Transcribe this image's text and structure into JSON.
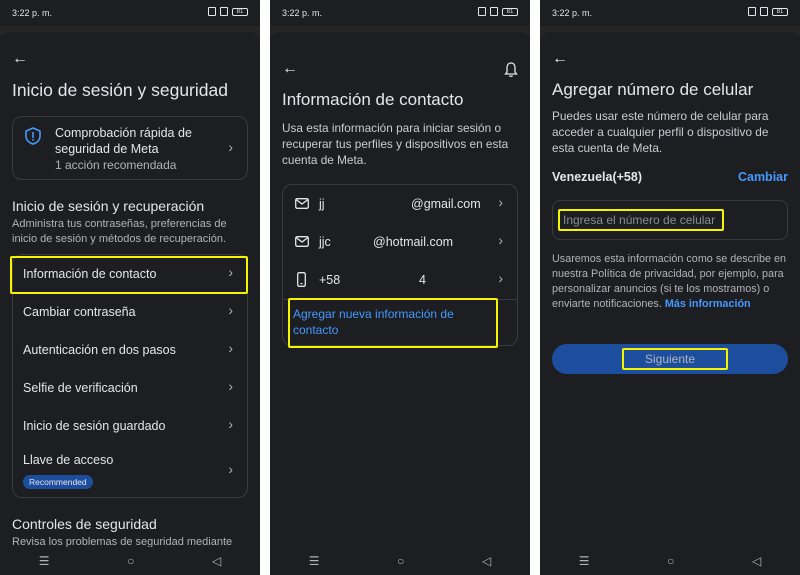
{
  "status": {
    "time": "3:22 p. m.",
    "battery": "81"
  },
  "screen1": {
    "title": "Inicio de sesión y seguridad",
    "quick_check": {
      "title": "Comprobación rápida de seguridad de Meta",
      "subtitle": "1 acción recomendada"
    },
    "section_title": "Inicio de sesión y recuperación",
    "section_desc": "Administra tus contraseñas, preferencias de inicio de sesión y métodos de recuperación.",
    "items": [
      {
        "label": "Información de contacto"
      },
      {
        "label": "Cambiar contraseña"
      },
      {
        "label": "Autenticación en dos pasos"
      },
      {
        "label": "Selfie de verificación"
      },
      {
        "label": "Inicio de sesión guardado"
      },
      {
        "label": "Llave de acceso",
        "badge": "Recommended"
      }
    ],
    "security_title": "Controles de seguridad",
    "security_desc": "Revisa los problemas de seguridad mediante"
  },
  "screen2": {
    "title": "Información de contacto",
    "desc": "Usa esta información para iniciar sesión o recuperar tus perfiles y dispositivos en esta cuenta de Meta.",
    "contacts": [
      {
        "prefix": "jj",
        "value": "@gmail.com",
        "icon": "mail-icon"
      },
      {
        "prefix": "jjc",
        "value": "@hotmail.com",
        "icon": "mail-icon"
      },
      {
        "prefix": "+58",
        "value": "4",
        "icon": "phone-icon"
      }
    ],
    "add_link": "Agregar nueva información de contacto"
  },
  "screen3": {
    "title": "Agregar número de celular",
    "desc": "Puedes usar este número de celular para acceder a cualquier perfil o dispositivo de esta cuenta de Meta.",
    "country": "Venezuela(+58)",
    "change": "Cambiar",
    "input_placeholder": "Ingresa el número de celular",
    "privacy": "Usaremos esta información como se describe en nuestra Política de privacidad, por ejemplo, para personalizar anuncios (si te los mostramos) o enviarte notificaciones.",
    "more": "Más información",
    "next": "Siguiente"
  },
  "colors": {
    "highlight": "#f5f500",
    "link": "#4599ff",
    "button": "#1d4e9e"
  }
}
